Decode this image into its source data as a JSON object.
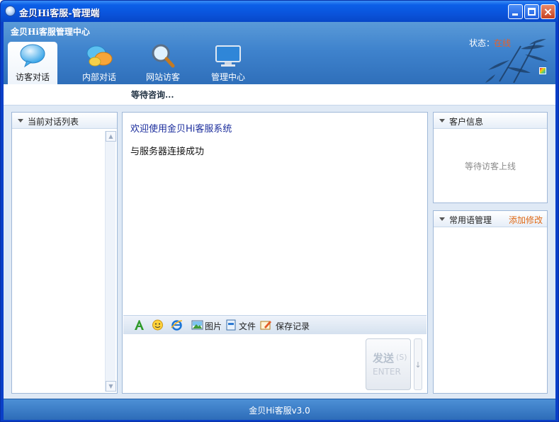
{
  "window": {
    "title": "金贝Hi客服-管理端",
    "close_glyph": "×"
  },
  "header": {
    "center_title": "金贝Hi客服管理中心",
    "status_label": "状态：",
    "status_value": "在线",
    "status_color": "#e8602a"
  },
  "tabs": [
    {
      "label": "访客对话",
      "icon": "chat-bubble-icon",
      "active": true
    },
    {
      "label": "内部对话",
      "icon": "group-chat-icon",
      "active": false
    },
    {
      "label": "网站访客",
      "icon": "magnifier-icon",
      "active": false
    },
    {
      "label": "管理中心",
      "icon": "monitor-icon",
      "active": false
    }
  ],
  "wait_bar": {
    "text": "等待咨询..."
  },
  "left_panel": {
    "title": "当前对话列表"
  },
  "chat": {
    "messages": [
      {
        "text": "欢迎使用金贝Hi客服系统",
        "color": "#1a2c9c"
      },
      {
        "text": "与服务器连接成功",
        "color": "#111111"
      }
    ],
    "toolbar": {
      "font_icon": "font-color-icon",
      "emoji_icon": "smiley-icon",
      "ie_icon": "browser-icon",
      "image_label": "图片",
      "file_label": "文件",
      "save_label": "保存记录"
    },
    "send_button": {
      "label": "发送",
      "shortcut": "(S)",
      "key": "ENTER"
    },
    "send_options_glyph": "↓"
  },
  "customer_panel": {
    "title": "客户信息",
    "waiting_text": "等待访客上线"
  },
  "phrase_panel": {
    "title": "常用语管理",
    "action_label": "添加修改",
    "action_color": "#e06a16"
  },
  "footer": {
    "version_text": "金贝Hi客服v3.0"
  }
}
